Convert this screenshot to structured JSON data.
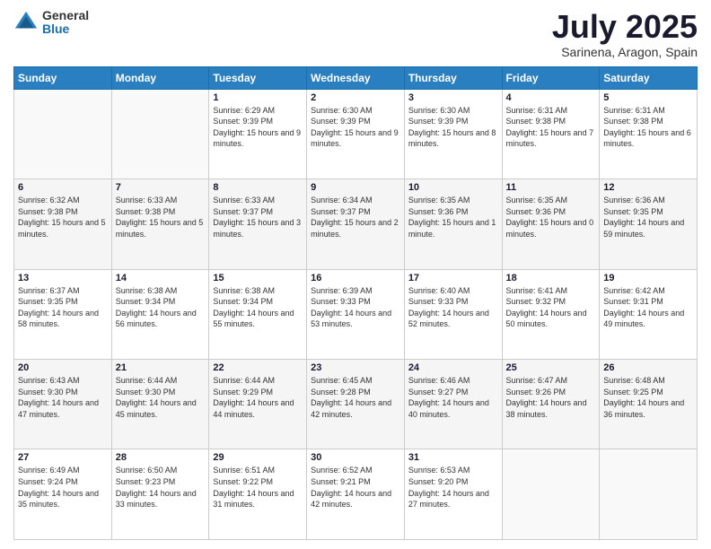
{
  "logo": {
    "general": "General",
    "blue": "Blue"
  },
  "header": {
    "month": "July 2025",
    "location": "Sarinena, Aragon, Spain"
  },
  "weekdays": [
    "Sunday",
    "Monday",
    "Tuesday",
    "Wednesday",
    "Thursday",
    "Friday",
    "Saturday"
  ],
  "weeks": [
    [
      {
        "day": "",
        "sunrise": "",
        "sunset": "",
        "daylight": ""
      },
      {
        "day": "",
        "sunrise": "",
        "sunset": "",
        "daylight": ""
      },
      {
        "day": "1",
        "sunrise": "Sunrise: 6:29 AM",
        "sunset": "Sunset: 9:39 PM",
        "daylight": "Daylight: 15 hours and 9 minutes."
      },
      {
        "day": "2",
        "sunrise": "Sunrise: 6:30 AM",
        "sunset": "Sunset: 9:39 PM",
        "daylight": "Daylight: 15 hours and 9 minutes."
      },
      {
        "day": "3",
        "sunrise": "Sunrise: 6:30 AM",
        "sunset": "Sunset: 9:39 PM",
        "daylight": "Daylight: 15 hours and 8 minutes."
      },
      {
        "day": "4",
        "sunrise": "Sunrise: 6:31 AM",
        "sunset": "Sunset: 9:38 PM",
        "daylight": "Daylight: 15 hours and 7 minutes."
      },
      {
        "day": "5",
        "sunrise": "Sunrise: 6:31 AM",
        "sunset": "Sunset: 9:38 PM",
        "daylight": "Daylight: 15 hours and 6 minutes."
      }
    ],
    [
      {
        "day": "6",
        "sunrise": "Sunrise: 6:32 AM",
        "sunset": "Sunset: 9:38 PM",
        "daylight": "Daylight: 15 hours and 5 minutes."
      },
      {
        "day": "7",
        "sunrise": "Sunrise: 6:33 AM",
        "sunset": "Sunset: 9:38 PM",
        "daylight": "Daylight: 15 hours and 5 minutes."
      },
      {
        "day": "8",
        "sunrise": "Sunrise: 6:33 AM",
        "sunset": "Sunset: 9:37 PM",
        "daylight": "Daylight: 15 hours and 3 minutes."
      },
      {
        "day": "9",
        "sunrise": "Sunrise: 6:34 AM",
        "sunset": "Sunset: 9:37 PM",
        "daylight": "Daylight: 15 hours and 2 minutes."
      },
      {
        "day": "10",
        "sunrise": "Sunrise: 6:35 AM",
        "sunset": "Sunset: 9:36 PM",
        "daylight": "Daylight: 15 hours and 1 minute."
      },
      {
        "day": "11",
        "sunrise": "Sunrise: 6:35 AM",
        "sunset": "Sunset: 9:36 PM",
        "daylight": "Daylight: 15 hours and 0 minutes."
      },
      {
        "day": "12",
        "sunrise": "Sunrise: 6:36 AM",
        "sunset": "Sunset: 9:35 PM",
        "daylight": "Daylight: 14 hours and 59 minutes."
      }
    ],
    [
      {
        "day": "13",
        "sunrise": "Sunrise: 6:37 AM",
        "sunset": "Sunset: 9:35 PM",
        "daylight": "Daylight: 14 hours and 58 minutes."
      },
      {
        "day": "14",
        "sunrise": "Sunrise: 6:38 AM",
        "sunset": "Sunset: 9:34 PM",
        "daylight": "Daylight: 14 hours and 56 minutes."
      },
      {
        "day": "15",
        "sunrise": "Sunrise: 6:38 AM",
        "sunset": "Sunset: 9:34 PM",
        "daylight": "Daylight: 14 hours and 55 minutes."
      },
      {
        "day": "16",
        "sunrise": "Sunrise: 6:39 AM",
        "sunset": "Sunset: 9:33 PM",
        "daylight": "Daylight: 14 hours and 53 minutes."
      },
      {
        "day": "17",
        "sunrise": "Sunrise: 6:40 AM",
        "sunset": "Sunset: 9:33 PM",
        "daylight": "Daylight: 14 hours and 52 minutes."
      },
      {
        "day": "18",
        "sunrise": "Sunrise: 6:41 AM",
        "sunset": "Sunset: 9:32 PM",
        "daylight": "Daylight: 14 hours and 50 minutes."
      },
      {
        "day": "19",
        "sunrise": "Sunrise: 6:42 AM",
        "sunset": "Sunset: 9:31 PM",
        "daylight": "Daylight: 14 hours and 49 minutes."
      }
    ],
    [
      {
        "day": "20",
        "sunrise": "Sunrise: 6:43 AM",
        "sunset": "Sunset: 9:30 PM",
        "daylight": "Daylight: 14 hours and 47 minutes."
      },
      {
        "day": "21",
        "sunrise": "Sunrise: 6:44 AM",
        "sunset": "Sunset: 9:30 PM",
        "daylight": "Daylight: 14 hours and 45 minutes."
      },
      {
        "day": "22",
        "sunrise": "Sunrise: 6:44 AM",
        "sunset": "Sunset: 9:29 PM",
        "daylight": "Daylight: 14 hours and 44 minutes."
      },
      {
        "day": "23",
        "sunrise": "Sunrise: 6:45 AM",
        "sunset": "Sunset: 9:28 PM",
        "daylight": "Daylight: 14 hours and 42 minutes."
      },
      {
        "day": "24",
        "sunrise": "Sunrise: 6:46 AM",
        "sunset": "Sunset: 9:27 PM",
        "daylight": "Daylight: 14 hours and 40 minutes."
      },
      {
        "day": "25",
        "sunrise": "Sunrise: 6:47 AM",
        "sunset": "Sunset: 9:26 PM",
        "daylight": "Daylight: 14 hours and 38 minutes."
      },
      {
        "day": "26",
        "sunrise": "Sunrise: 6:48 AM",
        "sunset": "Sunset: 9:25 PM",
        "daylight": "Daylight: 14 hours and 36 minutes."
      }
    ],
    [
      {
        "day": "27",
        "sunrise": "Sunrise: 6:49 AM",
        "sunset": "Sunset: 9:24 PM",
        "daylight": "Daylight: 14 hours and 35 minutes."
      },
      {
        "day": "28",
        "sunrise": "Sunrise: 6:50 AM",
        "sunset": "Sunset: 9:23 PM",
        "daylight": "Daylight: 14 hours and 33 minutes."
      },
      {
        "day": "29",
        "sunrise": "Sunrise: 6:51 AM",
        "sunset": "Sunset: 9:22 PM",
        "daylight": "Daylight: 14 hours and 31 minutes."
      },
      {
        "day": "30",
        "sunrise": "Sunrise: 6:52 AM",
        "sunset": "Sunset: 9:21 PM",
        "daylight": "Daylight: 14 hours and 42 minutes."
      },
      {
        "day": "31",
        "sunrise": "Sunrise: 6:53 AM",
        "sunset": "Sunset: 9:20 PM",
        "daylight": "Daylight: 14 hours and 27 minutes."
      },
      {
        "day": "",
        "sunrise": "",
        "sunset": "",
        "daylight": ""
      },
      {
        "day": "",
        "sunrise": "",
        "sunset": "",
        "daylight": ""
      }
    ]
  ]
}
